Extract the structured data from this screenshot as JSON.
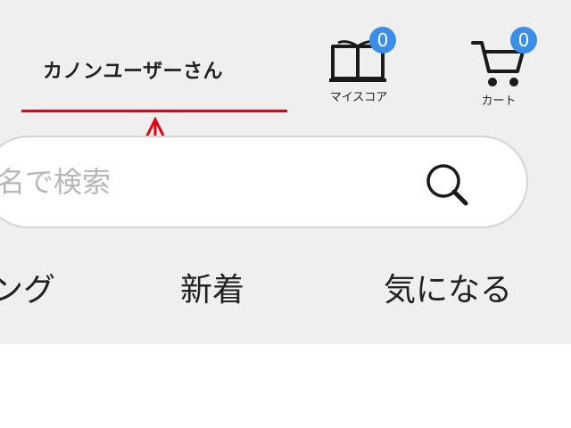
{
  "header": {
    "user_name": "カノンユーザーさん",
    "my_score": {
      "label": "マイスコア",
      "badge": "0",
      "icon": "book-icon"
    },
    "cart": {
      "label": "カート",
      "badge": "0",
      "icon": "cart-icon"
    }
  },
  "search": {
    "placeholder": "ト名で検索",
    "value": ""
  },
  "tabs": [
    {
      "label": "ング"
    },
    {
      "label": "新着"
    },
    {
      "label": "気になる"
    }
  ],
  "colors": {
    "badge": "#3a8ee6",
    "annotation": "#e60012",
    "header_bg": "#efefef"
  }
}
